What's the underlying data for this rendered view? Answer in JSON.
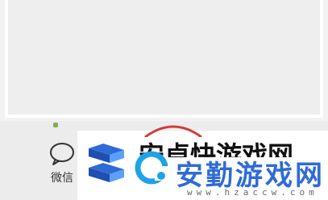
{
  "share": {
    "wechat_label": "微信",
    "icon": "wechat-chat-bubble-icon"
  },
  "heading": {
    "partial_text": "安卓快游戏网"
  },
  "watermark": {
    "name": "安勤游戏网",
    "url": "www.hzaccw.com",
    "colors": {
      "primary": "#2f6bd6",
      "accent": "#1ea3e8"
    }
  }
}
